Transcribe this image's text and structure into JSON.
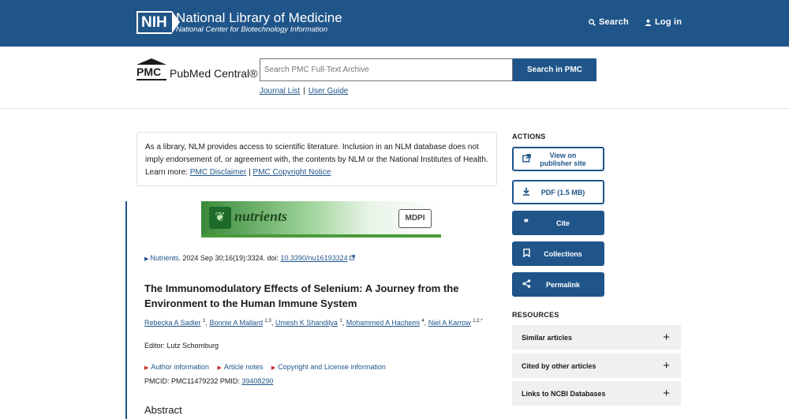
{
  "header": {
    "logo": "NIH",
    "title": "National Library of Medicine",
    "subtitle": "National Center for Biotechnology Information",
    "search_label": "Search",
    "login_label": "Log in"
  },
  "pmc": {
    "logo_abbr": "PMC",
    "logo_name": "PubMed Central®",
    "search_placeholder": "Search PMC Full-Text Archive",
    "search_button": "Search in PMC",
    "journal_list": "Journal List",
    "user_guide": "User Guide"
  },
  "disclaimer": {
    "text": "As a library, NLM provides access to scientific literature. Inclusion in an NLM database does not imply endorsement of, or agreement with, the contents by NLM or the National Institutes of Health.",
    "learn_more": "Learn more:",
    "link1": "PMC Disclaimer",
    "sep": "|",
    "link2": "PMC Copyright Notice"
  },
  "banner": {
    "journal": "nutrients",
    "publisher": "MDPI"
  },
  "article": {
    "journal_link": "Nutrients",
    "citation": ". 2024 Sep 30;16(19):3324. doi: ",
    "doi": "10.3390/nu16193324",
    "title": "The Immunomodulatory Effects of Selenium: A Journey from the Environment to the Human Immune System",
    "authors": [
      {
        "name": "Rebecka A Sadler",
        "sup": "1"
      },
      {
        "name": "Bonnie A Mallard",
        "sup": "2,3"
      },
      {
        "name": "Umesh K Shandilya",
        "sup": "1"
      },
      {
        "name": "Mohammed A Hachemi",
        "sup": "4"
      },
      {
        "name": "Niel A Karrow",
        "sup": "1,2,*"
      }
    ],
    "editor": "Editor: Lutz Schomburg",
    "info_links": [
      "Author information",
      "Article notes",
      "Copyright and License information"
    ],
    "pmcid": "PMCID: PMC11479232  PMID: ",
    "pmid": "39408290",
    "abstract_heading": "Abstract"
  },
  "actions": {
    "heading": "ACTIONS",
    "buttons": [
      {
        "label": "View on publisher site",
        "icon": "external-link-icon"
      },
      {
        "label": "PDF (1.5 MB)",
        "icon": "download-icon"
      },
      {
        "label": "Cite",
        "icon": "quote-icon"
      },
      {
        "label": "Collections",
        "icon": "bookmark-icon"
      },
      {
        "label": "Permalink",
        "icon": "share-icon"
      }
    ]
  },
  "resources": {
    "heading": "RESOURCES",
    "items": [
      "Similar articles",
      "Cited by other articles",
      "Links to NCBI Databases"
    ]
  },
  "colors": {
    "primary": "#20558a",
    "accent_red": "#c42b2b"
  }
}
